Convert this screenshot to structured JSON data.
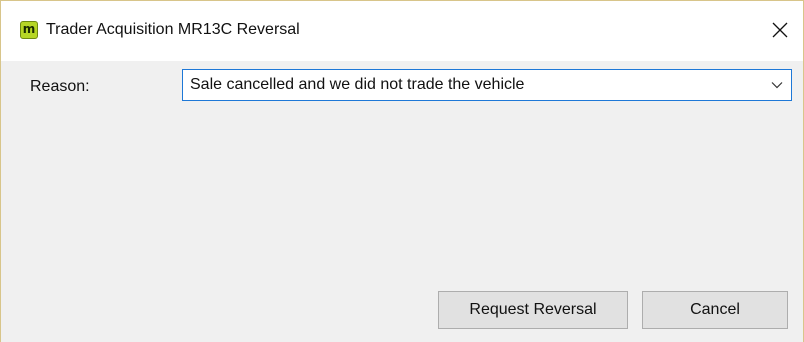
{
  "window": {
    "title": "Trader Acquisition MR13C Reversal",
    "app_icon_letter": "m",
    "app_icon_color": "#b6d626",
    "close_icon": "close-icon"
  },
  "form": {
    "reason_label": "Reason:",
    "reason_value": "Sale cancelled and we did not trade the vehicle",
    "dropdown_icon": "chevron-down-icon",
    "focus_border_color": "#1e78d7"
  },
  "buttons": {
    "request_reversal": "Request Reversal",
    "cancel": "Cancel"
  }
}
